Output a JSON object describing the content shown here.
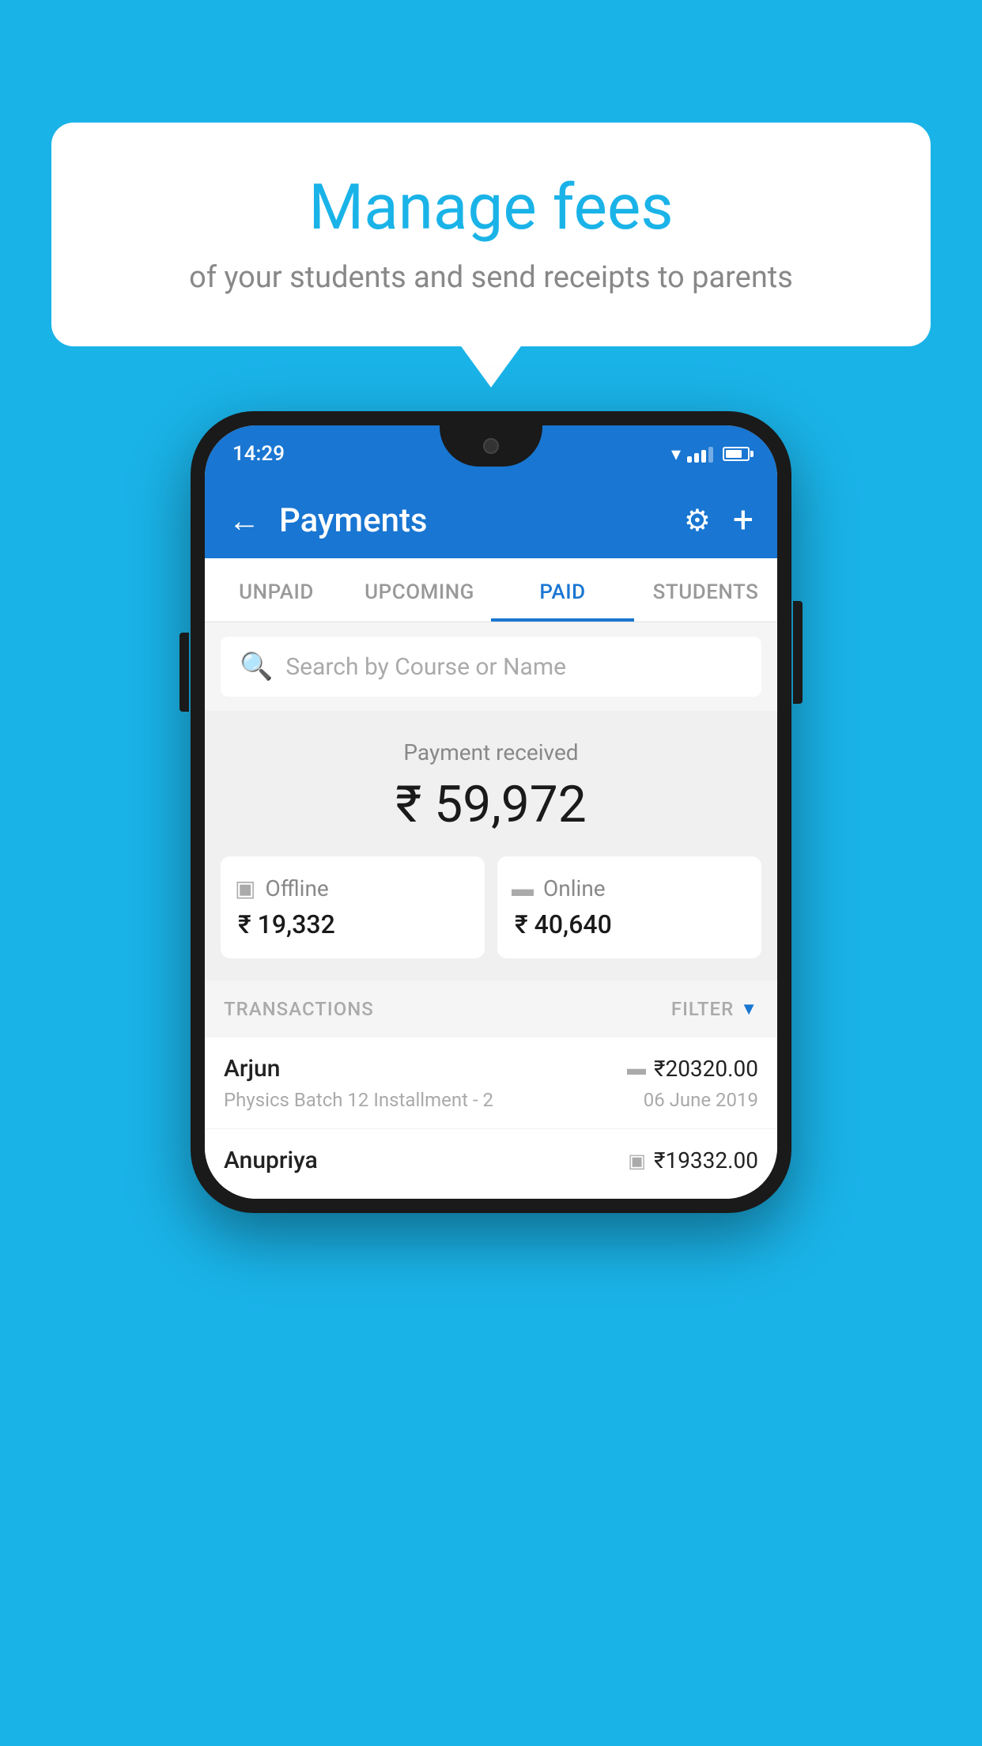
{
  "background_color": "#1ab3e8",
  "bubble": {
    "title": "Manage fees",
    "subtitle": "of your students and send receipts to parents"
  },
  "phone": {
    "status_bar": {
      "time": "14:29"
    },
    "header": {
      "title": "Payments",
      "back_label": "←",
      "gear_label": "⚙",
      "plus_label": "+"
    },
    "tabs": [
      {
        "label": "UNPAID",
        "active": false
      },
      {
        "label": "UPCOMING",
        "active": false
      },
      {
        "label": "PAID",
        "active": true
      },
      {
        "label": "STUDENTS",
        "active": false
      }
    ],
    "search": {
      "placeholder": "Search by Course or Name"
    },
    "payment_summary": {
      "label": "Payment received",
      "total_amount": "₹ 59,972",
      "offline_label": "Offline",
      "offline_amount": "₹ 19,332",
      "online_label": "Online",
      "online_amount": "₹ 40,640"
    },
    "transactions": {
      "section_label": "TRANSACTIONS",
      "filter_label": "FILTER",
      "items": [
        {
          "name": "Arjun",
          "course": "Physics Batch 12 Installment - 2",
          "amount": "₹20320.00",
          "date": "06 June 2019",
          "payment_type": "card"
        },
        {
          "name": "Anupriya",
          "course": "",
          "amount": "₹19332.00",
          "date": "",
          "payment_type": "offline"
        }
      ]
    }
  }
}
